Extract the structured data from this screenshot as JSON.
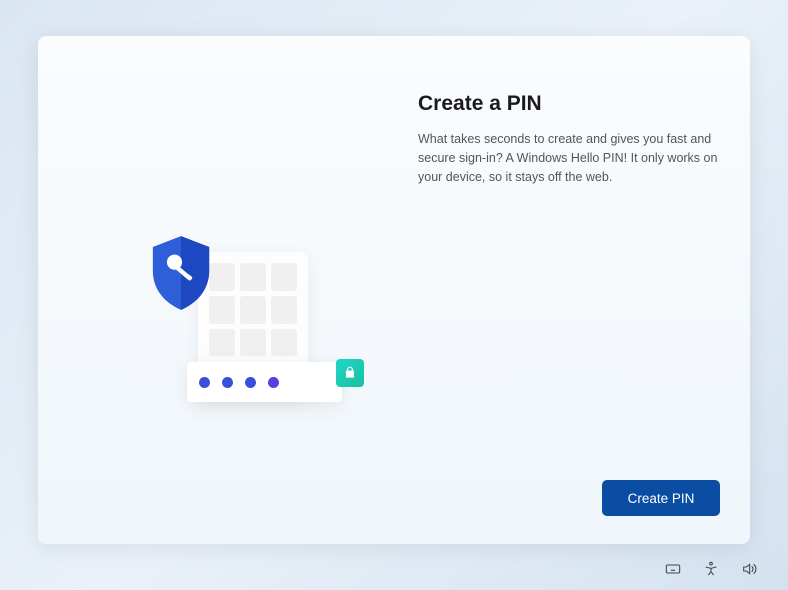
{
  "title": "Create a PIN",
  "description": "What takes seconds to create and gives you fast and secure sign-in? A Windows Hello PIN! It only works on your device, so it stays off the web.",
  "button_label": "Create PIN",
  "illustration": {
    "shield": "shield-key",
    "keypad": "numeric-keypad",
    "pin_dots": 4,
    "lock": "shopping-lock"
  },
  "tray": {
    "keyboard": "on-screen-keyboard",
    "accessibility": "accessibility",
    "volume": "volume"
  }
}
